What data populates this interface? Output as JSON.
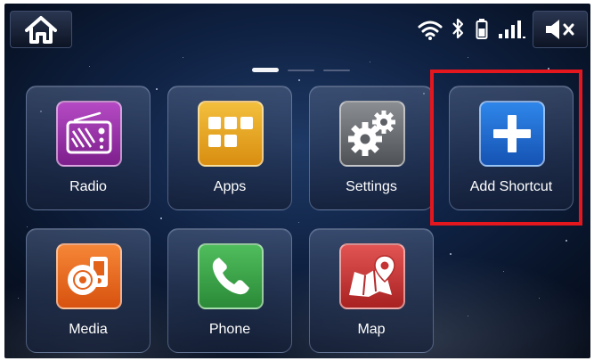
{
  "status_bar": {
    "home_icon": "home-icon",
    "indicators": [
      "wifi-icon",
      "bluetooth-icon",
      "battery-icon",
      "signal-strength-icon"
    ],
    "mute_icon": "mute-icon"
  },
  "page_indicator": {
    "current_page": 1,
    "total_pages": 3
  },
  "tiles": [
    {
      "label": "Radio",
      "icon": "radio-icon",
      "color": "#9b2fa8"
    },
    {
      "label": "Apps",
      "icon": "apps-grid-icon",
      "color": "#e6a51c"
    },
    {
      "label": "Settings",
      "icon": "settings-gears-icon",
      "color": "#6b6e73"
    },
    {
      "label": "Add Shortcut",
      "icon": "plus-icon",
      "color": "#1f6fd6"
    },
    {
      "label": "Media",
      "icon": "media-icon",
      "color": "#ee6a1a"
    },
    {
      "label": "Phone",
      "icon": "phone-icon",
      "color": "#3aa34a"
    },
    {
      "label": "Map",
      "icon": "map-pin-icon",
      "color": "#d63b3b"
    }
  ],
  "highlight": {
    "target": "Add Shortcut",
    "color": "#e4171f"
  }
}
